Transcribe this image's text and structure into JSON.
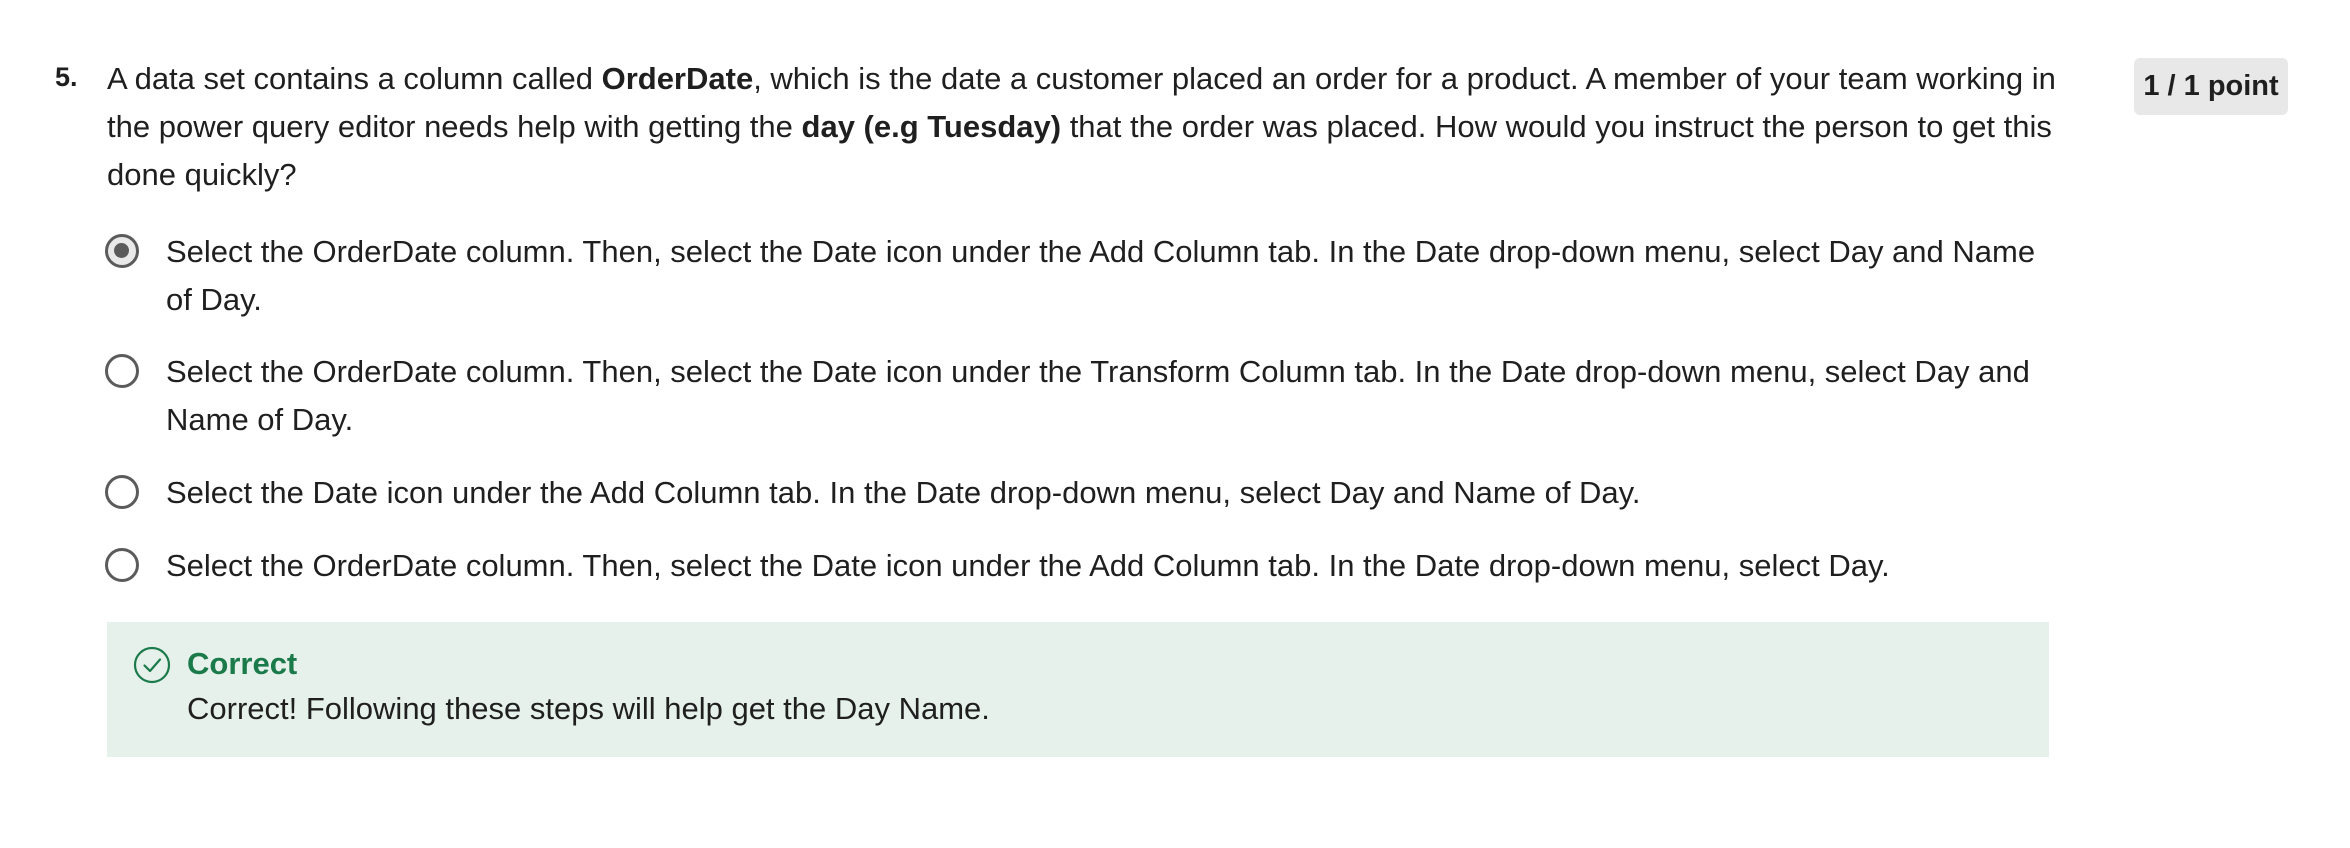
{
  "question": {
    "number": "5.",
    "text_parts": {
      "p1": "A data set contains a column called ",
      "b1": "OrderDate",
      "p2": ", which is the date a customer placed an order for a product. A member of your team working in the power query editor needs help with getting the ",
      "b2": "day (e.g Tuesday)",
      "p3": " that the order was placed. How would you instruct the person to get this done quickly?"
    },
    "points": "1 / 1 point"
  },
  "options": [
    {
      "label": "Select the OrderDate column. Then, select the Date icon under the Add Column tab. In the Date drop-down menu, select Day and Name of Day.",
      "selected": true
    },
    {
      "label": "Select the OrderDate column. Then, select the Date icon under the Transform Column tab. In the Date drop-down menu, select Day and Name of Day.",
      "selected": false
    },
    {
      "label": "Select the Date icon under the Add Column tab. In the Date drop-down menu, select Day and Name of Day.",
      "selected": false
    },
    {
      "label": "Select the OrderDate column. Then, select the Date icon under the Add Column tab. In the Date drop-down menu, select Day.",
      "selected": false
    }
  ],
  "feedback": {
    "title": "Correct",
    "text": "Correct! Following these steps will help get the Day Name.",
    "icon": "check-circle-icon",
    "accent_color": "#1b7a4a",
    "background_color": "#e6f1ec"
  }
}
